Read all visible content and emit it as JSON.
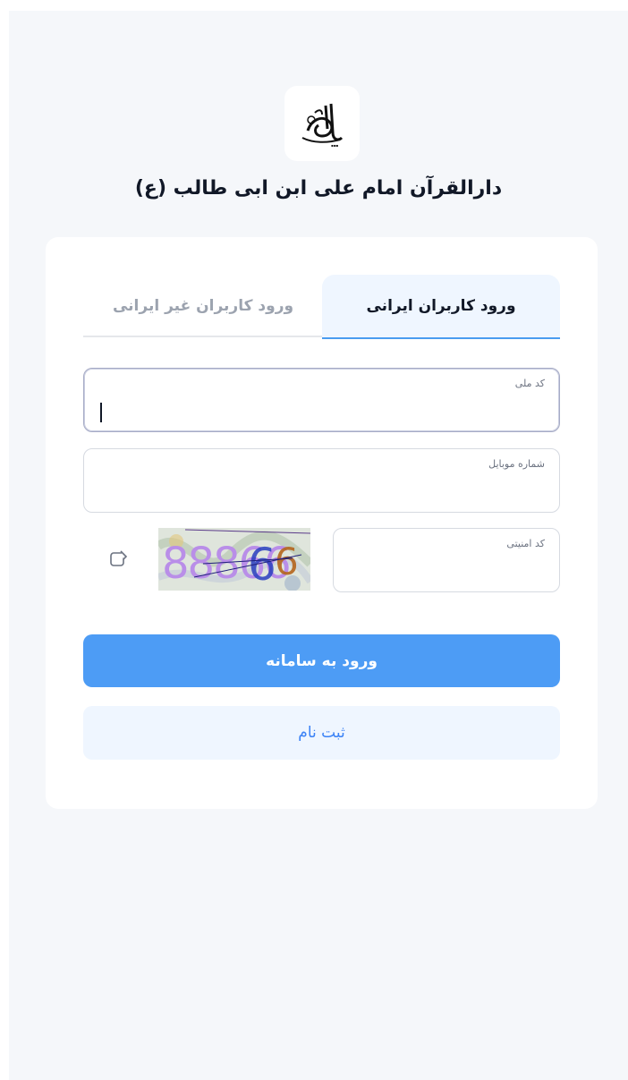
{
  "header": {
    "logo_icon": "calligraphy-logo",
    "title": "دارالقرآن امام علی ابن ابی طالب (ع)"
  },
  "tabs": [
    {
      "label": "ورود کاربران ایرانی",
      "active": true
    },
    {
      "label": "ورود کاربران غیر ایرانی",
      "active": false
    }
  ],
  "form": {
    "national_code": {
      "label": "کد ملی",
      "value": ""
    },
    "mobile": {
      "label": "شماره موبایل",
      "value": ""
    },
    "captcha": {
      "label": "کد امنیتی",
      "value": "",
      "image_text": "88866",
      "refresh_icon": "refresh-icon"
    }
  },
  "buttons": {
    "login": "ورود به سامانه",
    "register": "ثبت نام"
  },
  "colors": {
    "accent": "#4d9cf5",
    "accent_light": "#eff6ff",
    "page_bg": "#f5f7fa"
  }
}
